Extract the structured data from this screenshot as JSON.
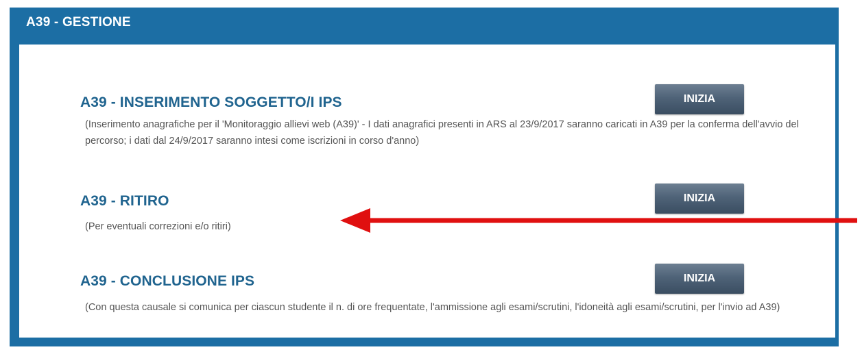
{
  "panel": {
    "title": "A39 - GESTIONE"
  },
  "items": [
    {
      "title": "A39 - INSERIMENTO SOGGETTO/I IPS",
      "description": "(Inserimento anagrafiche per il 'Monitoraggio allievi web (A39)' - I dati anagrafici presenti in ARS al 23/9/2017 saranno caricati in A39 per la conferma dell'avvio del percorso; i dati dal 24/9/2017 saranno intesi come iscrizioni in corso d'anno)",
      "button": "INIZIA"
    },
    {
      "title": "A39 - RITIRO",
      "description": "(Per eventuali correzioni e/o ritiri)",
      "button": "INIZIA"
    },
    {
      "title": "A39 - CONCLUSIONE IPS",
      "description": "(Con questa causale si comunica per ciascun studente il n. di ore frequentate, l'ammissione agli esami/scrutini, l'idoneità agli esami/scrutini, per l'invio ad A39)",
      "button": "INIZIA"
    }
  ],
  "annotation": {
    "arrow_color": "#e01010",
    "icon": "arrow-left-icon"
  },
  "colors": {
    "panel_blue": "#1c6ea4",
    "title_blue": "#20648f",
    "button_gray": "#4f6378"
  }
}
